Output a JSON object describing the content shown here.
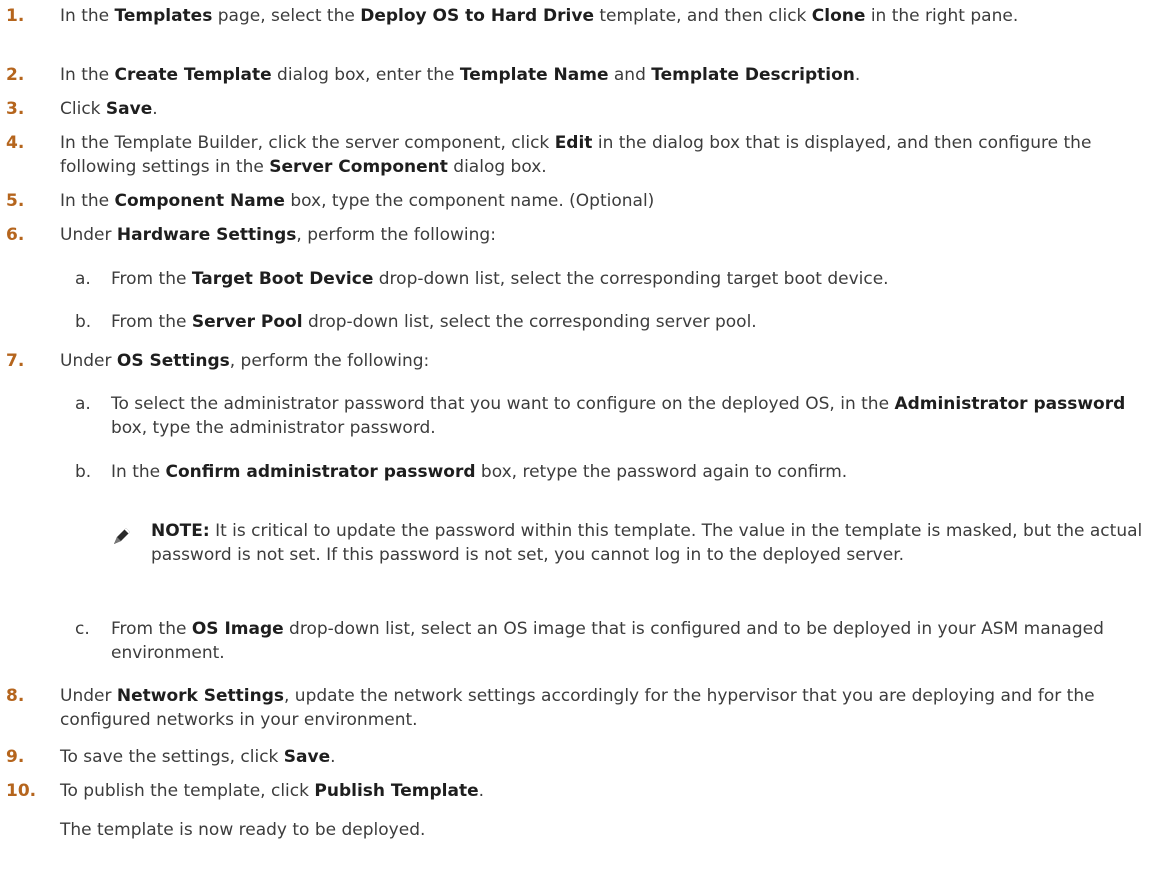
{
  "steps": [
    {
      "num": "1.",
      "parts": [
        {
          "t": "In the ",
          "b": false
        },
        {
          "t": "Templates",
          "b": true
        },
        {
          "t": " page, select the ",
          "b": false
        },
        {
          "t": "Deploy OS to Hard Drive",
          "b": true
        },
        {
          "t": " template, and then click ",
          "b": false
        },
        {
          "t": "Clone",
          "b": true
        },
        {
          "t": " in the right pane.",
          "b": false
        }
      ]
    },
    {
      "num": "2.",
      "parts": [
        {
          "t": "In the ",
          "b": false
        },
        {
          "t": "Create Template",
          "b": true
        },
        {
          "t": " dialog box, enter the ",
          "b": false
        },
        {
          "t": "Template Name",
          "b": true
        },
        {
          "t": " and ",
          "b": false
        },
        {
          "t": "Template Description",
          "b": true
        },
        {
          "t": ".",
          "b": false
        }
      ]
    },
    {
      "num": "3.",
      "parts": [
        {
          "t": "Click ",
          "b": false
        },
        {
          "t": "Save",
          "b": true
        },
        {
          "t": ".",
          "b": false
        }
      ]
    },
    {
      "num": "4.",
      "parts": [
        {
          "t": "In the Template Builder, click the server component, click ",
          "b": false
        },
        {
          "t": "Edit",
          "b": true
        },
        {
          "t": " in the dialog box that is displayed, and then configure the following settings in the ",
          "b": false
        },
        {
          "t": "Server Component",
          "b": true
        },
        {
          "t": " dialog box.",
          "b": false
        }
      ]
    },
    {
      "num": "5.",
      "parts": [
        {
          "t": "In the ",
          "b": false
        },
        {
          "t": "Component Name",
          "b": true
        },
        {
          "t": " box, type the component name. (Optional)",
          "b": false
        }
      ]
    },
    {
      "num": "6.",
      "parts": [
        {
          "t": "Under ",
          "b": false
        },
        {
          "t": "Hardware Settings",
          "b": true
        },
        {
          "t": ", perform the following:",
          "b": false
        }
      ]
    },
    {
      "num": "7.",
      "parts": [
        {
          "t": "Under ",
          "b": false
        },
        {
          "t": "OS Settings",
          "b": true
        },
        {
          "t": ", perform the following:",
          "b": false
        }
      ]
    },
    {
      "num": "8.",
      "parts": [
        {
          "t": "Under ",
          "b": false
        },
        {
          "t": "Network Settings",
          "b": true
        },
        {
          "t": ", update the network settings accordingly for the hypervisor that you are deploying and for the configured networks in your environment.",
          "b": false
        }
      ]
    },
    {
      "num": "9.",
      "parts": [
        {
          "t": "To save the settings, click ",
          "b": false
        },
        {
          "t": "Save",
          "b": true
        },
        {
          "t": ".",
          "b": false
        }
      ]
    },
    {
      "num": "10.",
      "parts": [
        {
          "t": "To publish the template, click ",
          "b": false
        },
        {
          "t": "Publish Template",
          "b": true
        },
        {
          "t": ".",
          "b": false
        }
      ]
    }
  ],
  "substeps": [
    {
      "letter": "a.",
      "parts": [
        {
          "t": "From the ",
          "b": false
        },
        {
          "t": "Target Boot Device",
          "b": true
        },
        {
          "t": " drop-down list, select the corresponding target boot device.",
          "b": false
        }
      ]
    },
    {
      "letter": "b.",
      "parts": [
        {
          "t": "From the ",
          "b": false
        },
        {
          "t": "Server Pool",
          "b": true
        },
        {
          "t": " drop-down list, select the corresponding server pool.",
          "b": false
        }
      ]
    },
    {
      "letter": "a.",
      "parts": [
        {
          "t": "To select the administrator password that you want to configure on the deployed OS, in the ",
          "b": false
        },
        {
          "t": "Administrator password",
          "b": true
        },
        {
          "t": " box, type the administrator password.",
          "b": false
        }
      ]
    },
    {
      "letter": "b.",
      "parts": [
        {
          "t": "In the ",
          "b": false
        },
        {
          "t": "Confirm administrator password",
          "b": true
        },
        {
          "t": " box, retype the password again to confirm.",
          "b": false
        }
      ]
    },
    {
      "letter": "c.",
      "parts": [
        {
          "t": "From the ",
          "b": false
        },
        {
          "t": "OS Image",
          "b": true
        },
        {
          "t": " drop-down list, select an OS image that is configured and to be deployed in your ASM managed environment.",
          "b": false
        }
      ]
    }
  ],
  "note": {
    "label": "NOTE:",
    "text": " It is critical to update the password within this template. The value in the template is masked, but the actual password is not set. If this password is not set, you cannot log in to the deployed server.",
    "icon": "pencil-note-icon"
  },
  "tail": "The template is now ready to be deployed."
}
